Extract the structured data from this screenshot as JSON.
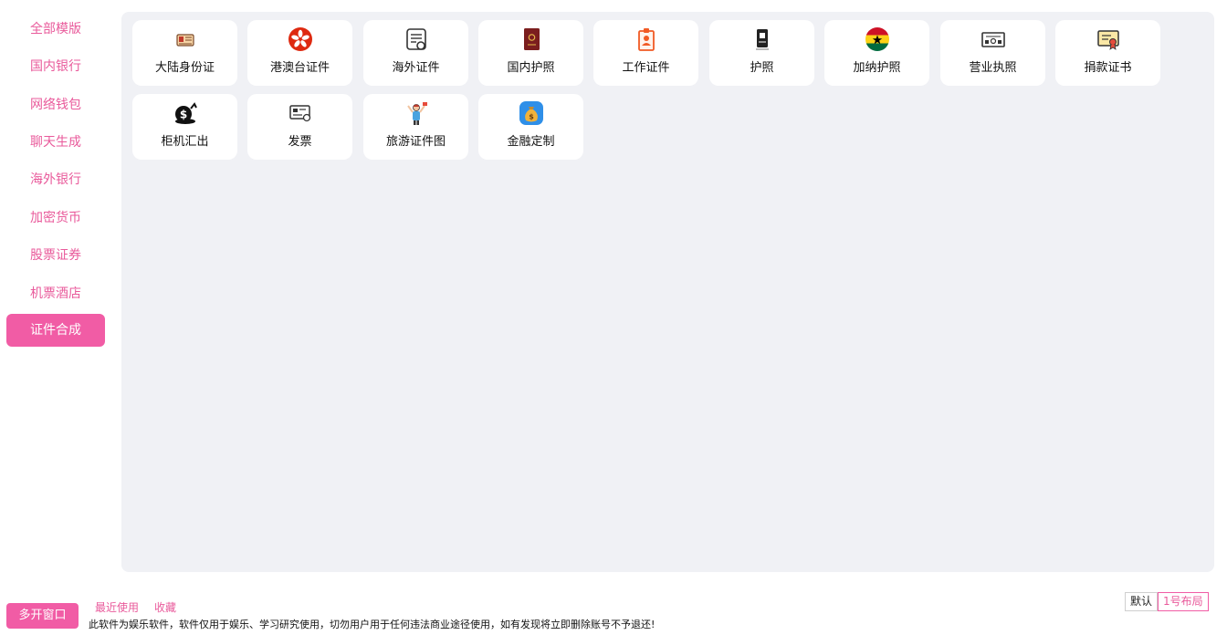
{
  "sidebar": {
    "items": [
      {
        "label": "全部模版"
      },
      {
        "label": "国内银行"
      },
      {
        "label": "网络钱包"
      },
      {
        "label": "聊天生成"
      },
      {
        "label": "海外银行"
      },
      {
        "label": "加密货币"
      },
      {
        "label": "股票证券"
      },
      {
        "label": "机票酒店"
      },
      {
        "label": "证件合成"
      }
    ],
    "active_label": "证件合成"
  },
  "cards": [
    {
      "label": "大陆身份证",
      "icon": "id-card-icon"
    },
    {
      "label": "港澳台证件",
      "icon": "hong-kong-flag-icon"
    },
    {
      "label": "海外证件",
      "icon": "certificate-document-icon"
    },
    {
      "label": "国内护照",
      "icon": "passport-book-icon"
    },
    {
      "label": "工作证件",
      "icon": "work-badge-icon"
    },
    {
      "label": "护照",
      "icon": "passport-icon"
    },
    {
      "label": "加纳护照",
      "icon": "ghana-flag-icon"
    },
    {
      "label": "营业执照",
      "icon": "business-license-icon"
    },
    {
      "label": "捐款证书",
      "icon": "donation-certificate-icon"
    },
    {
      "label": "柜机汇出",
      "icon": "dollar-transfer-icon"
    },
    {
      "label": "发票",
      "icon": "invoice-icon"
    },
    {
      "label": "旅游证件图",
      "icon": "traveler-photo-icon"
    },
    {
      "label": "金融定制",
      "icon": "money-bag-icon"
    }
  ],
  "footer": {
    "multi_window_label": "多开窗口",
    "recent_label": "最近使用",
    "favorites_label": "收藏",
    "disclaimer": "此软件为娱乐软件，软件仅用于娱乐、学习研究使用，切勿用户用于任何违法商业途径使用，如有发现将立即删除账号不予退还!",
    "layout_options": [
      {
        "label": "默认"
      },
      {
        "label": "1号布局"
      }
    ],
    "active_layout": "1号布局"
  },
  "colors": {
    "accent": "#f15ca5",
    "accent_text": "#e95a9b",
    "panel_bg": "#f0f1f5"
  }
}
